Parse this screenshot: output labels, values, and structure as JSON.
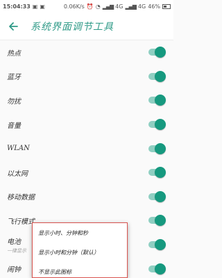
{
  "status_bar": {
    "time": "15:04:33",
    "speed": "0.06K/s",
    "network1": "4G",
    "network2": "4G",
    "battery": "46%"
  },
  "app_bar": {
    "title": "系统界面调节工具",
    "back_icon": "arrow-left-icon"
  },
  "colors": {
    "accent": "#2e9a87",
    "toggle_track": "#8fcfc2",
    "toggle_knob": "#16997f",
    "popup_border": "#d9534f"
  },
  "settings": [
    {
      "label": "热点",
      "on": true
    },
    {
      "label": "蓝牙",
      "on": true
    },
    {
      "label": "勿扰",
      "on": true
    },
    {
      "label": "音量",
      "on": true
    },
    {
      "label": "WLAN",
      "on": true
    },
    {
      "label": "以太网",
      "on": true
    },
    {
      "label": "移动数据",
      "on": true
    },
    {
      "label": "飞行模式",
      "on": true
    },
    {
      "label": "电池",
      "sublabel": "一律显示",
      "on": true
    },
    {
      "label": "闹钟",
      "on": true
    }
  ],
  "popup": {
    "options": [
      "显示小时、分钟和秒",
      "显示小时和分钟（默认）",
      "不显示此图标"
    ]
  }
}
